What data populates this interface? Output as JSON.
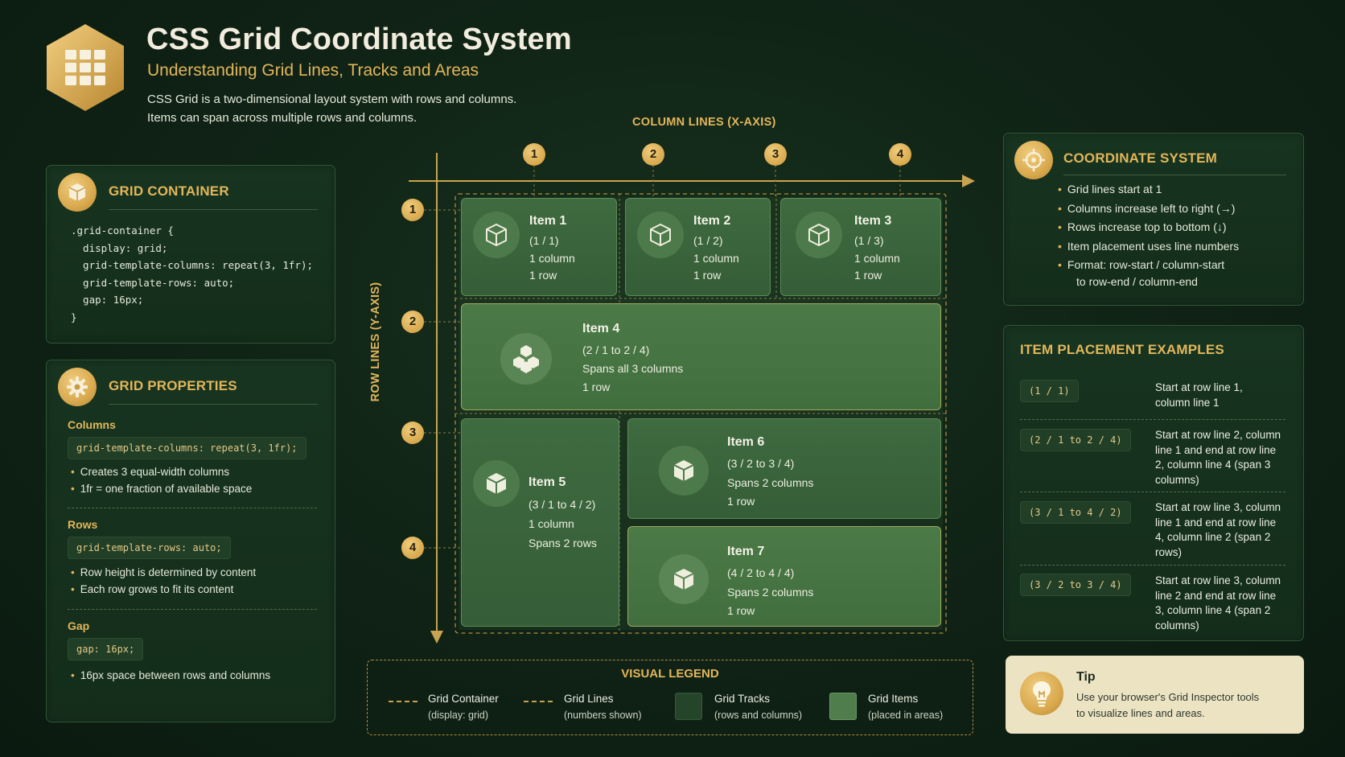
{
  "header": {
    "title": "CSS Grid Coordinate System",
    "subtitle": "Understanding Grid Lines, Tracks and Areas",
    "desc_line1": "CSS Grid is a two-dimensional layout system with rows and columns.",
    "desc_line2": "Items can span across multiple rows and columns.",
    "logo_icon": "grid-icon"
  },
  "grid_container": {
    "title": "GRID CONTAINER",
    "icon": "box-icon",
    "code": [
      ".grid-container {",
      "  display: grid;",
      "  grid-template-columns: repeat(3, 1fr);",
      "  grid-template-rows: auto;",
      "  gap: 16px;",
      "}"
    ]
  },
  "grid_properties": {
    "title": "GRID PROPERTIES",
    "icon": "gear-icon",
    "columns": {
      "label": "Columns",
      "code": "grid-template-columns: repeat(3, 1fr);",
      "bullets": [
        "Creates 3 equal-width columns",
        "1fr = one fraction of available space"
      ]
    },
    "rows": {
      "label": "Rows",
      "code": "grid-template-rows: auto;",
      "bullets": [
        "Row height is determined by content",
        "Each row grows to fit its content"
      ]
    },
    "gap": {
      "label": "Gap",
      "code": "gap: 16px;",
      "bullets": [
        "16px space between rows and columns"
      ]
    }
  },
  "diagram": {
    "x_axis_title": "COLUMN LINES (X-AXIS)",
    "y_axis_title": "ROW LINES (Y-AXIS)",
    "column_lines": [
      "1",
      "2",
      "3",
      "4"
    ],
    "row_lines": [
      "1",
      "2",
      "3",
      "4"
    ],
    "items": [
      {
        "name": "Item 1",
        "pos": "(1 / 1)",
        "l1": "1 column",
        "l2": "1 row"
      },
      {
        "name": "Item 2",
        "pos": "(1 / 2)",
        "l1": "1 column",
        "l2": "1 row"
      },
      {
        "name": "Item 3",
        "pos": "(1 / 3)",
        "l1": "1 column",
        "l2": "1 row"
      },
      {
        "name": "Item 4",
        "pos": "(2 / 1 to 2 / 4)",
        "l1": "Spans all 3 columns",
        "l2": "1 row"
      },
      {
        "name": "Item 5",
        "pos": "(3 / 1 to 4 / 2)",
        "l1": "1 column",
        "l2": "Spans 2 rows"
      },
      {
        "name": "Item 6",
        "pos": "(3 / 2 to 3 / 4)",
        "l1": "Spans 2 columns",
        "l2": "1 row"
      },
      {
        "name": "Item 7",
        "pos": "(4 / 2 to 4 / 4)",
        "l1": "Spans 2 columns",
        "l2": "1 row"
      }
    ]
  },
  "legend": {
    "title": "VISUAL LEGEND",
    "entries": [
      {
        "label": "Grid Container",
        "sub": "(display: grid)"
      },
      {
        "label": "Grid Lines",
        "sub": "(numbers shown)"
      },
      {
        "label": "Grid Tracks",
        "sub": "(rows and columns)"
      },
      {
        "label": "Grid Items",
        "sub": "(placed in areas)"
      }
    ]
  },
  "coordinate_system": {
    "title": "COORDINATE SYSTEM",
    "icon": "crosshair-icon",
    "bullets": [
      "Grid lines start at 1",
      "Columns increase left to right (→)",
      "Rows increase top to bottom (↓)",
      "Item placement uses line numbers",
      "Format: row-start / column-start"
    ],
    "continuation": "to row-end / column-end"
  },
  "placement_examples": {
    "title": "ITEM PLACEMENT EXAMPLES",
    "examples": [
      {
        "code": "(1 / 1)",
        "text": "Start at row line 1, column line 1"
      },
      {
        "code": "(2 / 1 to 2 / 4)",
        "text": "Start at row line 2, column line 1 and end at row line 2, column line 4 (span 3 columns)"
      },
      {
        "code": "(3 / 1 to 4 / 2)",
        "text": "Start at row line 3, column line 1 and end at row line 4, column line 2 (span 2 rows)"
      },
      {
        "code": "(3 / 2 to 3 / 4)",
        "text": "Start at row line 3, column line 2 and end at row line 3, column line 4 (span 2 columns)"
      }
    ]
  },
  "tip": {
    "title": "Tip",
    "line1": "Use your browser's Grid Inspector tools",
    "line2": "to visualize lines and areas.",
    "icon": "lightbulb-icon"
  },
  "colors": {
    "background": "#0f2215",
    "accent": "#e2b65a",
    "item_fill": "#3f6b40",
    "track_fill": "#24452a",
    "tip_bg": "#ece3c3"
  }
}
